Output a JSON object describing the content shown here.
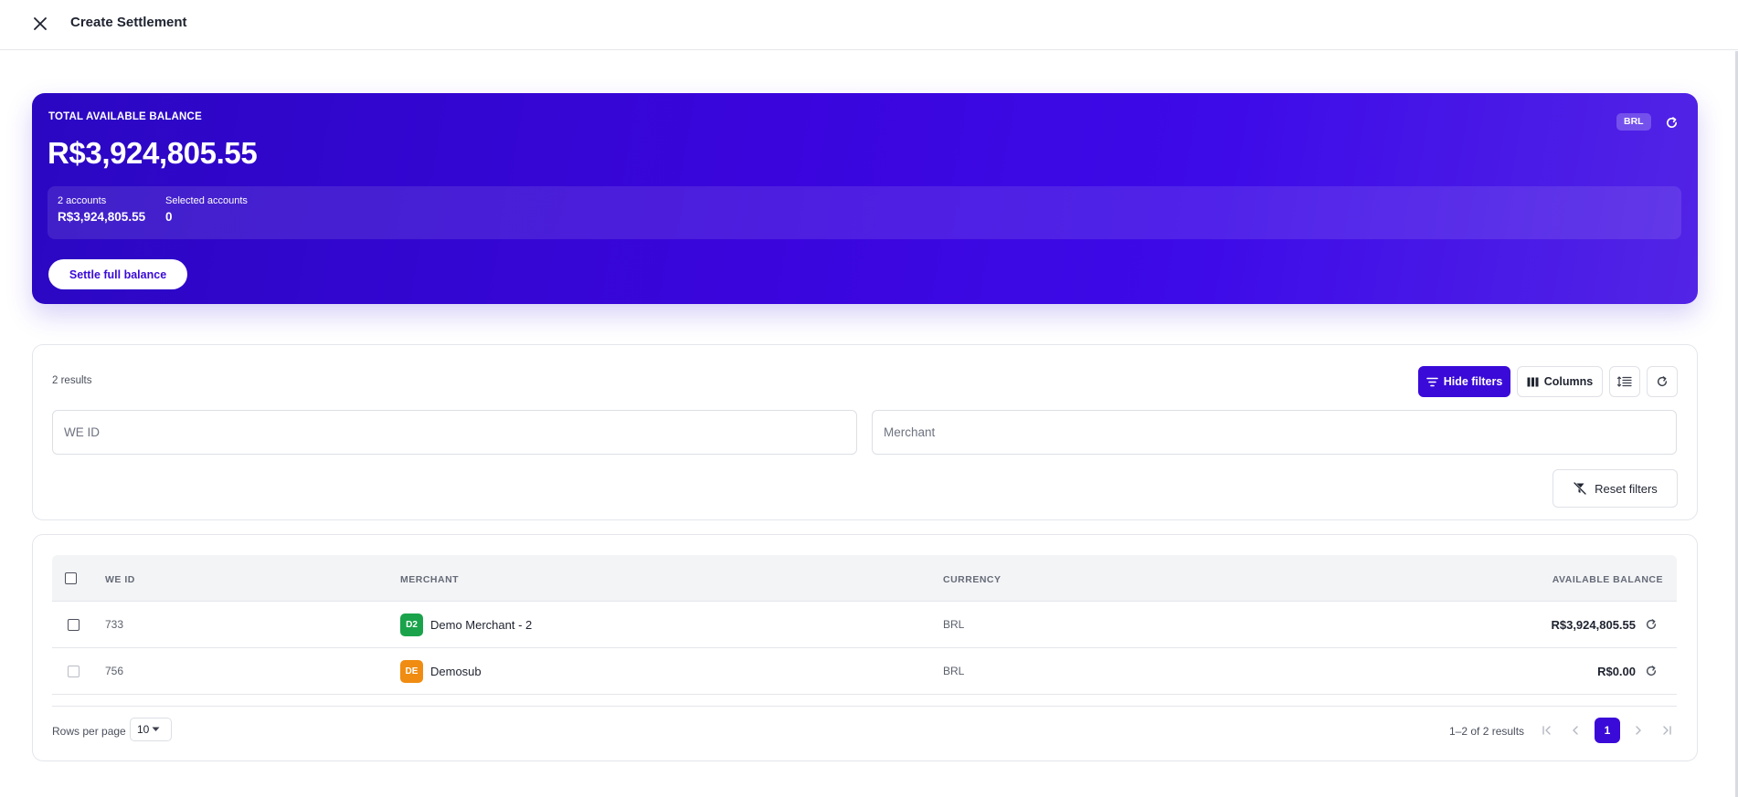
{
  "header": {
    "title": "Create Settlement",
    "close_icon": "close-icon"
  },
  "balance": {
    "label": "TOTAL AVAILABLE BALANCE",
    "amount": "R$3,924,805.55",
    "currency": "BRL",
    "accounts_label": "2 accounts",
    "accounts_value": "R$3,924,805.55",
    "selected_label": "Selected accounts",
    "selected_value": "0",
    "settle_button": "Settle full balance"
  },
  "filters": {
    "results_count": "2 results",
    "hide_filters": "Hide filters",
    "columns": "Columns",
    "we_id_placeholder": "WE ID",
    "merchant_placeholder": "Merchant",
    "reset_filters": "Reset filters"
  },
  "table": {
    "headers": {
      "we_id": "WE ID",
      "merchant": "MERCHANT",
      "currency": "CURRENCY",
      "balance": "AVAILABLE BALANCE"
    },
    "rows": [
      {
        "we_id": "733",
        "avatar": "D2",
        "avatar_color": "#1aa34a",
        "merchant": "Demo Merchant - 2",
        "currency": "BRL",
        "balance": "R$3,924,805.55"
      },
      {
        "we_id": "756",
        "avatar": "DE",
        "avatar_color": "#f08c11",
        "merchant": "Demosub",
        "currency": "BRL",
        "balance": "R$0.00"
      }
    ],
    "rows_per_page_label": "Rows per page",
    "rows_per_page": "10",
    "page_range": "1–2 of 2 results",
    "current_page": "1"
  },
  "colors": {
    "primary": "#3a0ad8",
    "card_gradient_start": "#2b07c2",
    "card_gradient_end": "#5224e6"
  }
}
